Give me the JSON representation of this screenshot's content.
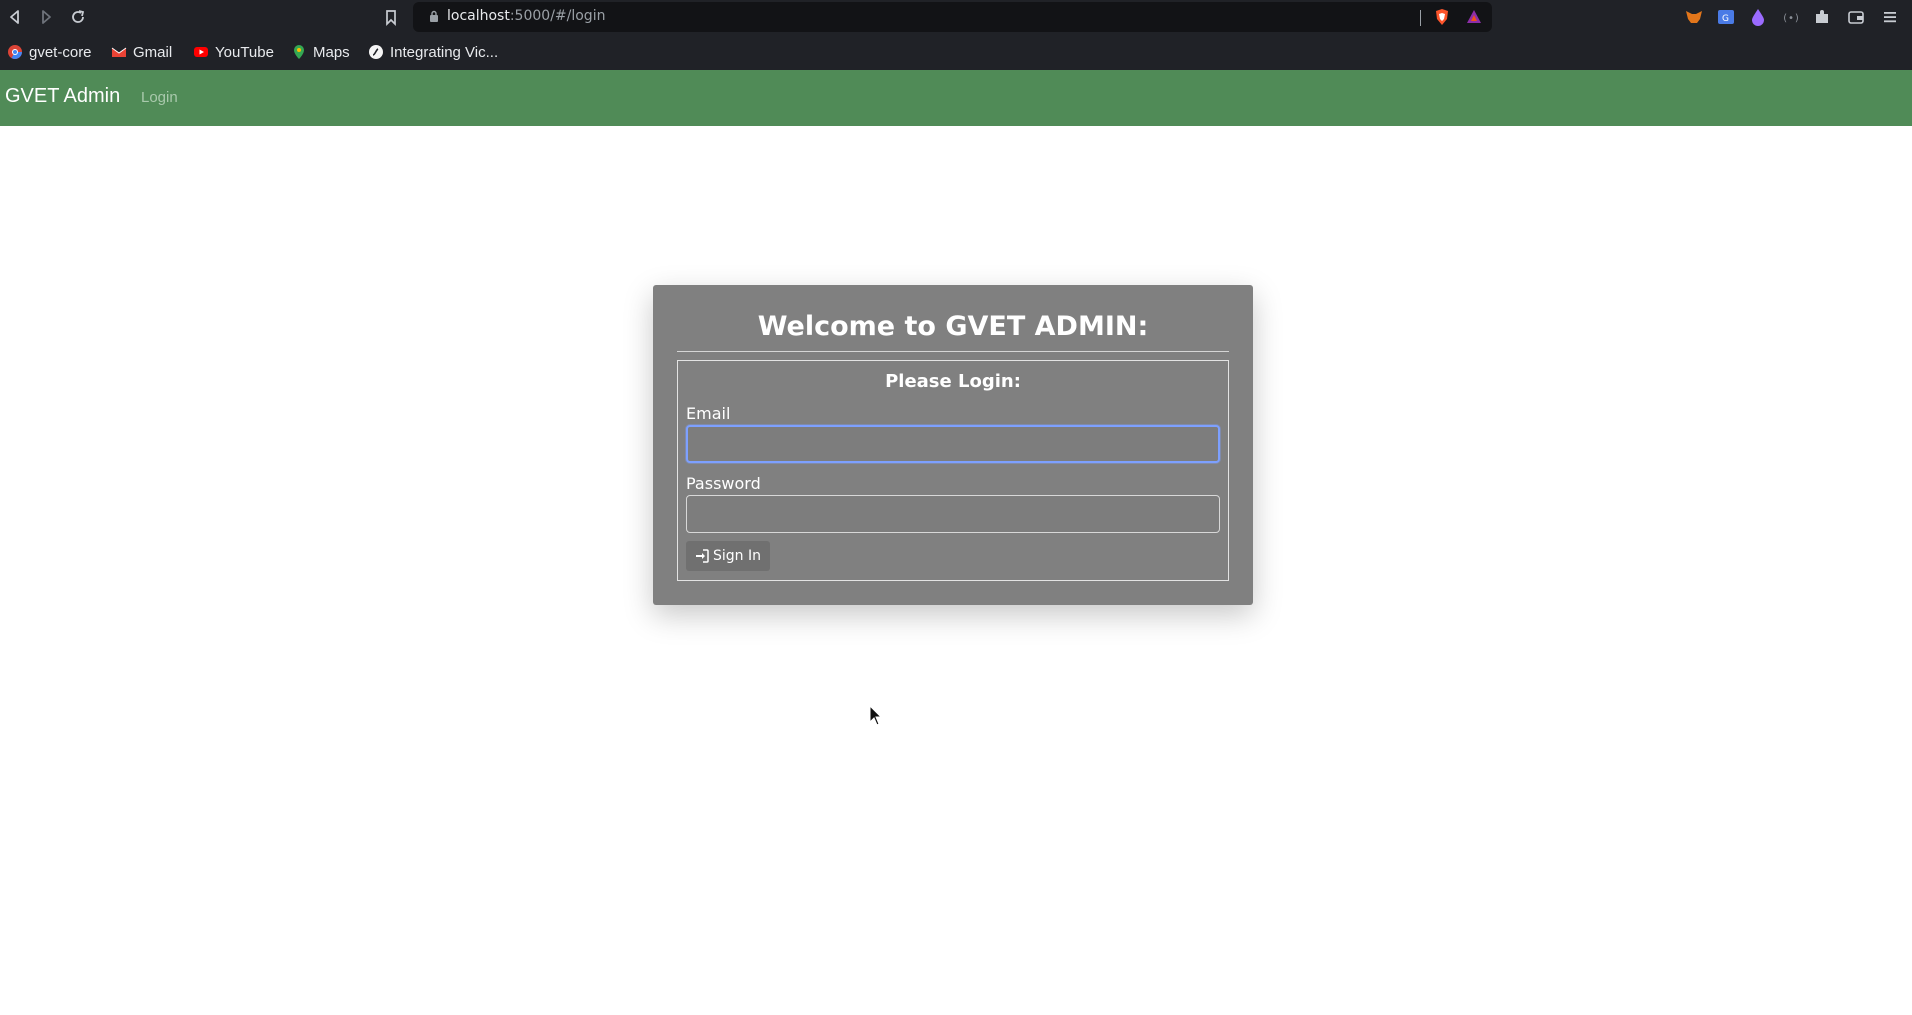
{
  "browser": {
    "url_host": "localhost",
    "url_rest": ":5000/#/login",
    "bookmarks": [
      {
        "label": "gvet-core",
        "icon": "chrome-icon"
      },
      {
        "label": "Gmail",
        "icon": "gmail-icon"
      },
      {
        "label": "YouTube",
        "icon": "youtube-icon"
      },
      {
        "label": "Maps",
        "icon": "maps-icon"
      },
      {
        "label": "Integrating Vic...",
        "icon": "symfony-icon"
      }
    ]
  },
  "navbar": {
    "brand": "GVET Admin",
    "login_link": "Login",
    "color": "#508b57"
  },
  "login": {
    "title": "Welcome to GVET ADMIN:",
    "subtitle": "Please Login:",
    "email_label": "Email",
    "email_value": "",
    "password_label": "Password",
    "password_value": "",
    "signin_label": "Sign In",
    "card_color": "#808080"
  }
}
